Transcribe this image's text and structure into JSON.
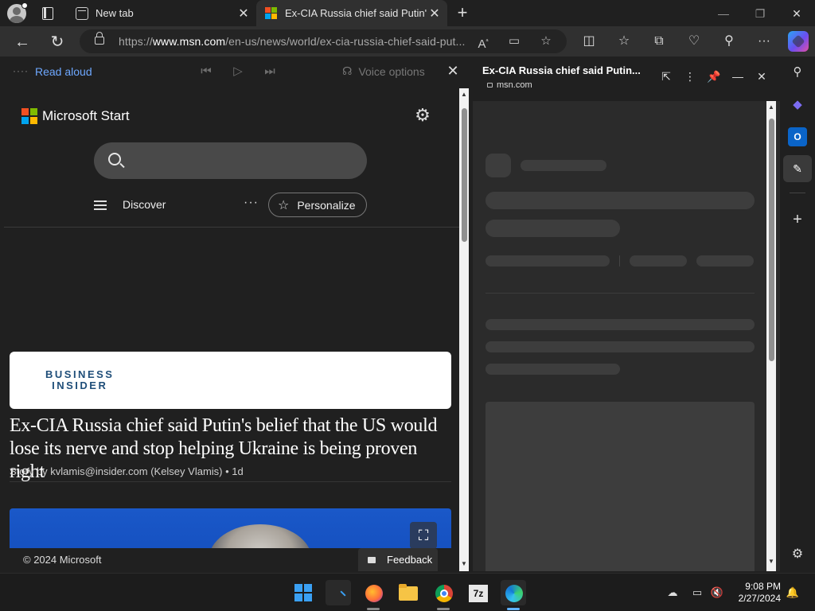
{
  "tabs": [
    {
      "label": "New tab"
    },
    {
      "label": "Ex-CIA Russia chief said Putin's b"
    }
  ],
  "address_bar": {
    "url_prefix": "https://",
    "url_host": "www.msn.com",
    "url_path": "/en-us/news/world/ex-cia-russia-chief-said-put..."
  },
  "read_aloud": {
    "label": "Read aloud",
    "voice_options": "Voice options"
  },
  "page": {
    "brand": "Microsoft Start",
    "discover": "Discover",
    "personalize": "Personalize",
    "publisher": "BUSINESS\nINSIDER",
    "headline": "Ex-CIA Russia chief said Putin's belief that the US would lose its nerve and stop helping Ukraine is being proven right",
    "byline": "Story by kvlamis@insider.com (Kelsey Vlamis) •  1d",
    "copyright": "© 2024 Microsoft",
    "feedback": "Feedback"
  },
  "side_panel": {
    "title": "Ex-CIA Russia chief said Putin...",
    "domain": "msn.com"
  },
  "taskbar": {
    "time": "9:08 PM",
    "date": "2/27/2024"
  },
  "colors": {
    "accent_link": "#6ea8ff",
    "ms_red": "#f25022",
    "ms_green": "#7fba00",
    "ms_blue": "#00a4ef",
    "ms_yellow": "#ffb900"
  }
}
